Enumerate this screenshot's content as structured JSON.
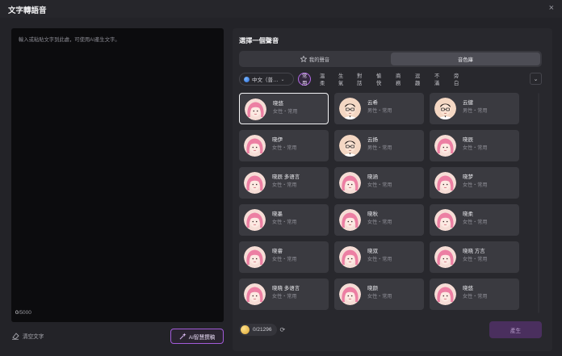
{
  "window": {
    "title": "文字轉語音",
    "close_glyph": "×"
  },
  "editor": {
    "placeholder": "輸入或粘貼文字到此處，可使用AI產生文字。",
    "count_current": "0",
    "count_max": "/5000"
  },
  "actions": {
    "clear_label": "清空文字",
    "ai_label": "AI智慧撰稿"
  },
  "panel": {
    "title": "選擇一個聲音",
    "tabs": [
      {
        "label": "我的聲音",
        "icon": "star-icon"
      },
      {
        "label": "音色庫"
      }
    ],
    "language": "中文（普…",
    "filters": [
      "常用",
      "溫柔",
      "生氣",
      "對話",
      "愉快",
      "商務",
      "逗趣",
      "不滿",
      "旁白"
    ],
    "active_filter": 0
  },
  "voices": [
    {
      "name": "晓悠",
      "tag": "女性・常用",
      "avatar": "female",
      "selected": true
    },
    {
      "name": "云希",
      "tag": "男性・常用",
      "avatar": "male"
    },
    {
      "name": "云健",
      "tag": "男性・常用",
      "avatar": "male"
    },
    {
      "name": "晓伊",
      "tag": "女性・常用",
      "avatar": "female"
    },
    {
      "name": "云扬",
      "tag": "男性・常用",
      "avatar": "male"
    },
    {
      "name": "晓辰",
      "tag": "女性・常用",
      "avatar": "female"
    },
    {
      "name": "晓辰 多语言",
      "tag": "女性・常用",
      "avatar": "female"
    },
    {
      "name": "晓涵",
      "tag": "女性・常用",
      "avatar": "female"
    },
    {
      "name": "晓梦",
      "tag": "女性・常用",
      "avatar": "female"
    },
    {
      "name": "晓墨",
      "tag": "女性・常用",
      "avatar": "female"
    },
    {
      "name": "晓秋",
      "tag": "女性・常用",
      "avatar": "female"
    },
    {
      "name": "晓柔",
      "tag": "女性・常用",
      "avatar": "female"
    },
    {
      "name": "晓睿",
      "tag": "女性・常用",
      "avatar": "female"
    },
    {
      "name": "晓双",
      "tag": "女性・常用",
      "avatar": "female"
    },
    {
      "name": "晓晓 方言",
      "tag": "女性・常用",
      "avatar": "female"
    },
    {
      "name": "晓晓 多语言",
      "tag": "女性・常用",
      "avatar": "female"
    },
    {
      "name": "晓颜",
      "tag": "女性・常用",
      "avatar": "female"
    },
    {
      "name": "晓悠",
      "tag": "女性・常用",
      "avatar": "female"
    }
  ],
  "footer": {
    "credits": "0/21296",
    "generate_label": "產生"
  },
  "colors": {
    "accent": "#a25bd9",
    "background": "#232328",
    "panel": "#28282d",
    "card": "#3a3a40"
  }
}
